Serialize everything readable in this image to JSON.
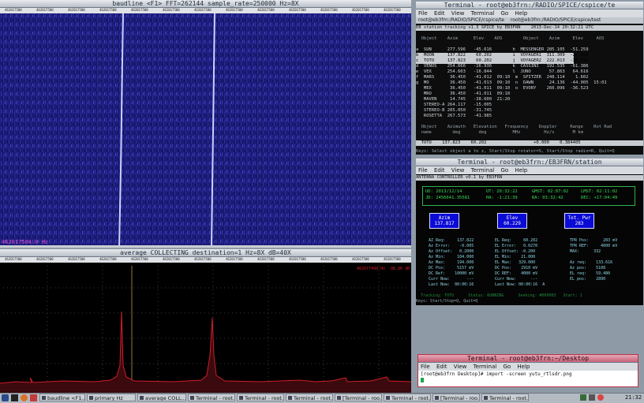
{
  "colors": {
    "spectrum_bg": "#1a1a7a",
    "signal": "#c8d2ff",
    "trace": "#d21c2a",
    "panel_green": "#3bdc57",
    "button_blue": "#0b0bd6"
  },
  "baudline": {
    "title": "baudline  <F1>  FFT=262144 sample_rate=250000 Hz=8X",
    "freq_readout": "462017504.0 Hz",
    "average_title": "average  COLLECTING destination=1 Hz=8X dB=40X",
    "ruler_ticks": [
      "462017500",
      "462017500",
      "462017500",
      "462017500",
      "462017500",
      "462017500",
      "462017500",
      "462017500",
      "462017500",
      "462017500",
      "462017500",
      "462017500",
      "462017500"
    ],
    "avg_marker": "462077498 Hz",
    "avg_marker_db": "-98.86 dB"
  },
  "spice": {
    "title": "Terminal - root@eb3frn:/RADIO/SPICE/cspice/te",
    "menu": [
      "File",
      "Edit",
      "View",
      "Terminal",
      "Go",
      "Help"
    ],
    "tab": "root@eb3frn:/RADIO/SPICE/cspice/te",
    "tab2": "root@eb3frn:/RADIO/SPICE/cspice/test",
    "header": "EB station tracking v1.3 SPICE by EB3FRN    2013-Dec-14 20:32:21 UTC",
    "col_headers": "  Object    Azim      Elev    AOS        Object    Azim     Elev     AOS",
    "rows": [
      "a  SUN      277.596   -45.616        h  MESSENGER 285.105  -51.259",
      "b  MOON     137.822    60.202        i  VOYAGER1  311.309  -22.843",
      "c  TOTO     137.823    60.202        j  VOYAGER2  222.013  -34.719",
      "d  VENUS    254.666   -16.936        k  CASSINI   192.535  -61.386",
      "e  VEX      254.603   -16.844        l  JUNO       57.863   64.616",
      "f  MARS      36.450   -41.012  09:10  m  SPITZER  248.114    1.602",
      "g  MO        36.450   -41.013  09:10  n  DAWN      24.136  -44.005  15:01",
      "   MEX       36.450   -41.011  09:10  o  EVORY    260.096  -36.523",
      "   MRO       36.450   -41.011  09:10",
      "   MAVEN     14.745   -38.600  21:20",
      "   STEREO-A 264.117   -15.005",
      "   STEREO-B 205.050   -31.745",
      "   ROSETTA  267.573   -41.985"
    ],
    "bottom_headers": "  Object    Azimuth   Elevation   Frequency    Doppler     Range    Rot Rad\n  name        deg       deg          MHz         Hz/s       M km",
    "bottom_values": "  TOTO    137.823    60.202                  +0.000    0.384405",
    "keys": "Keys: Select object a to z, Start/Stop rotator=S, Start/Stop radio=R, Quit=Q"
  },
  "station": {
    "title": "Terminal - root@eb3frn:/EB3FRN/station",
    "menu": [
      "File",
      "Edit",
      "View",
      "Terminal",
      "Go",
      "Help"
    ],
    "header": "ANTENNA CONTROLLER v0.1 by EB3FRN",
    "ud": "UD: 2013/12/14",
    "ut": "UT: 20:32:22",
    "gmst": "GMST: 02:07:02",
    "lmst": "LMST: 02:11:02",
    "jd": "JD: 2456641.35581",
    "ha": "HA: -1:21:39",
    "ra": "RA: 03:32:42",
    "dec": "DEC: +17:04:49",
    "azim_btn": "Azim\n137.817",
    "elev_btn": "Elev\n60.229",
    "pwr_btn": "Tot. Pwr\n283",
    "left_block": "  AZ Req:     137.822\n  Az Error:    -0.005\n  Az Offset:   0.2000\n  Az Min:     104.000\n  Az Max:     194.000\n  DC Pos:     5157 mV\n  DC Ref:    10000 mV\n  Curr Now:       ---\n  Last Now:  00:00:16",
    "mid_block": "EL Req:     60.202\nEL Error:   0.0270\nEL Offset: -0.200\nEL Min:    21.000\nEL Max:   329.000\nDC Pos:    2910 mV\nDC REF:    4000 mV\nCurr Now:      ---\nLast Now: 00:00:16  A",
    "right_block": "TPR Pos:      283 mV\nTPR REF:     4000 mV\nMAX:      332\n\nAz req:    133.616\nAz pos:    5108\nEL req:    59.480\nEL pos:    2890",
    "status_line": "  Tracking: TOTO      Status: RUNNING      Seeking: #000003   Start: 1",
    "keys": "Keys: Start/Stop=Q, Quit=Q"
  },
  "desktop": {
    "title": "Terminal - root@eb3frn:~/Desktop",
    "menu": [
      "File",
      "Edit",
      "View",
      "Terminal",
      "Go",
      "Help"
    ],
    "line": "[root@eb3frn Desktop]# import -screen yutu_rtlsdr.png"
  },
  "taskbar": {
    "items": [
      "baudline  <F1...",
      "primary Hz",
      "average  COLL...",
      "Terminal - root...",
      "Terminal - root...",
      "Terminal - root...",
      "[Terminal - roo...",
      "Terminal - root...",
      "[Terminal - roo...",
      "Terminal - root..."
    ],
    "clock": "21:32"
  }
}
